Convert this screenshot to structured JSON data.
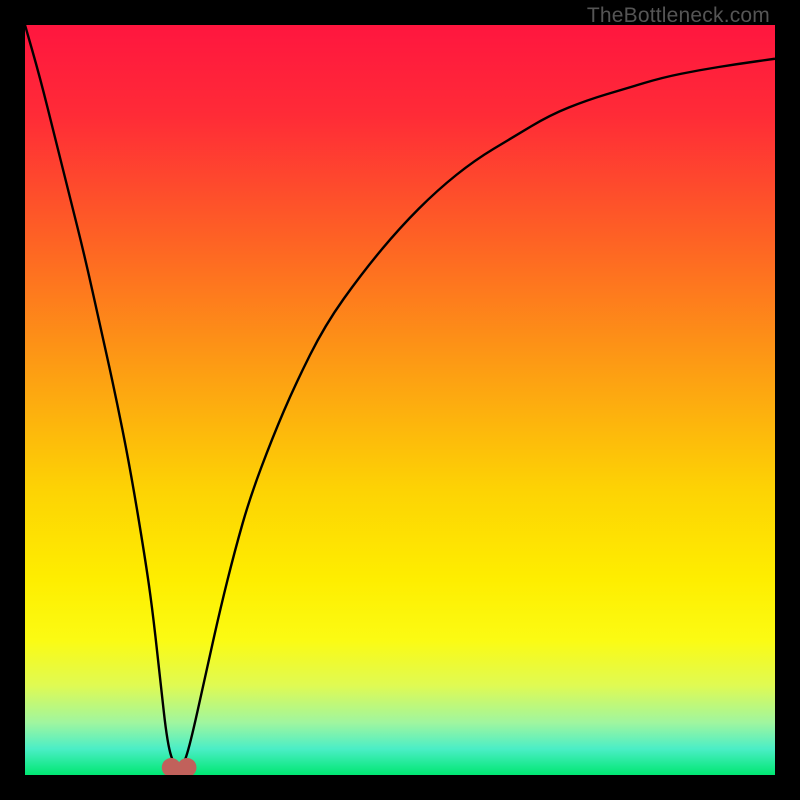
{
  "watermark": "TheBottleneck.com",
  "colors": {
    "frame": "#000000",
    "watermark": "#555555",
    "curve": "#000000",
    "marker_fill": "#c1615b",
    "gradient_stops": [
      {
        "offset": 0.0,
        "color": "#ff163f"
      },
      {
        "offset": 0.12,
        "color": "#ff2b37"
      },
      {
        "offset": 0.28,
        "color": "#fe6025"
      },
      {
        "offset": 0.45,
        "color": "#fd9a14"
      },
      {
        "offset": 0.62,
        "color": "#fdd304"
      },
      {
        "offset": 0.74,
        "color": "#feee00"
      },
      {
        "offset": 0.82,
        "color": "#fbfb13"
      },
      {
        "offset": 0.88,
        "color": "#e0fa52"
      },
      {
        "offset": 0.93,
        "color": "#a0f69f"
      },
      {
        "offset": 0.965,
        "color": "#4beec6"
      },
      {
        "offset": 1.0,
        "color": "#00e772"
      }
    ]
  },
  "chart_data": {
    "type": "line",
    "title": "",
    "xlabel": "",
    "ylabel": "",
    "xlim": [
      0,
      100
    ],
    "ylim": [
      0,
      100
    ],
    "series": [
      {
        "name": "bottleneck-curve",
        "x": [
          0,
          2,
          4,
          6,
          8,
          10,
          12,
          14,
          16,
          17,
          18,
          19,
          20,
          21,
          22,
          24,
          26,
          28,
          30,
          33,
          36,
          40,
          45,
          50,
          55,
          60,
          65,
          70,
          75,
          80,
          85,
          90,
          95,
          100
        ],
        "values": [
          100,
          93,
          85,
          77,
          69,
          60,
          51,
          41,
          29,
          22,
          13,
          4,
          1,
          1,
          4,
          13,
          22,
          30,
          37,
          45,
          52,
          60,
          67,
          73,
          78,
          82,
          85,
          88,
          90,
          91.5,
          93,
          94,
          94.8,
          95.5
        ]
      }
    ],
    "markers": [
      {
        "name": "valley-left",
        "x": 19.5,
        "y": 1
      },
      {
        "name": "valley-right",
        "x": 21.6,
        "y": 1
      }
    ],
    "annotations": []
  }
}
